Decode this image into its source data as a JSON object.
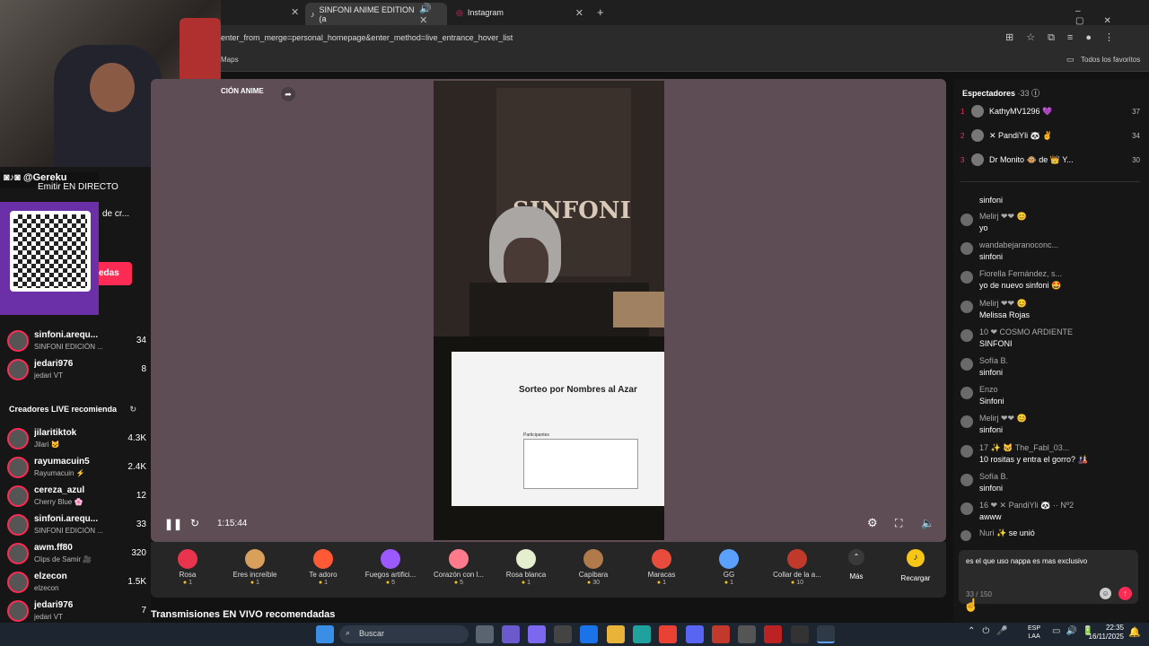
{
  "browser": {
    "tabs": [
      {
        "label": "SINFONI ANIME EDITION (a"
      },
      {
        "label": "Instagram"
      }
    ],
    "url": "enter_from_merge=personal_homepage&enter_method=live_entrance_hover_list",
    "bookmarks": {
      "left": "Maps",
      "right": "Todos los favoritos"
    }
  },
  "overlay": {
    "social": "@Gereku",
    "live_btn": "Emitir EN DIRECTO",
    "snippet": "de cr...",
    "button": "edas"
  },
  "player": {
    "live_label": "CIÓN ANIME",
    "time": "1:15:44",
    "screen_title": "Sorteo por Nombres al Azar",
    "screen_list_title": "Participantes"
  },
  "left": {
    "top_creators": [
      {
        "name": "sinfoni.arequ...",
        "sub": "SINFONI EDICIÓN ...",
        "count": "34"
      },
      {
        "name": "jedari976",
        "sub": "jedari VT",
        "count": "8"
      }
    ],
    "section_title": "Creadores LIVE recomienda",
    "creators": [
      {
        "name": "jilaritiktok",
        "sub": "Jilari 🐱",
        "count": "4.3K"
      },
      {
        "name": "rayumacuin5",
        "sub": "Rayumacuin ⚡",
        "count": "2.4K"
      },
      {
        "name": "cereza_azul",
        "sub": "Cherry Blue 🌸",
        "count": "12"
      },
      {
        "name": "sinfoni.arequ...",
        "sub": "SINFONI EDICIÓN ...",
        "count": "33"
      },
      {
        "name": "awm.ff80",
        "sub": "Clips de Samir 🎥",
        "count": "320"
      },
      {
        "name": "elzecon",
        "sub": "elzecon",
        "count": "1.5K"
      },
      {
        "name": "jedari976",
        "sub": "jedari VT",
        "count": "7"
      }
    ],
    "bottom_title": "Transmisiones EN VIVO recomendadas"
  },
  "gifts": [
    {
      "name": "Rosa",
      "price": "1",
      "color": "#e8344d"
    },
    {
      "name": "Eres increíble",
      "price": "1",
      "color": "#d9a05b"
    },
    {
      "name": "Te adoro",
      "price": "1",
      "color": "#ff5a36"
    },
    {
      "name": "Fuegos artifici...",
      "price": "5",
      "color": "#9b59ff"
    },
    {
      "name": "Corazón con l...",
      "price": "5",
      "color": "#ff7a8a"
    },
    {
      "name": "Rosa blanca",
      "price": "1",
      "color": "#e6eed0"
    },
    {
      "name": "Capibara",
      "price": "30",
      "color": "#b07a4a"
    },
    {
      "name": "Maracas",
      "price": "1",
      "color": "#e74c3c"
    },
    {
      "name": "GG",
      "price": "1",
      "color": "#5aa0ff"
    },
    {
      "name": "Collar de la a...",
      "price": "10",
      "color": "#c0392b"
    }
  ],
  "more_label": "Más",
  "recharge_label": "Recargar",
  "viewers": {
    "title": "Espectadores",
    "count": "·33",
    "list": [
      {
        "rank": "1",
        "name": "KathyMV1296 💜",
        "count": "37"
      },
      {
        "rank": "2",
        "name": "✕ PandiYli 🐼 ✌",
        "count": "34"
      },
      {
        "rank": "3",
        "name": "Dr Monito 🐵 de 👑 Y...",
        "count": "30"
      }
    ]
  },
  "chat": [
    {
      "user": "",
      "text": "sinfoni"
    },
    {
      "user": "Melirj ❤❤ 😊",
      "text": "yo"
    },
    {
      "user": "wandabejaranoconc...",
      "text": "sinfoni"
    },
    {
      "user": "Fiorella Fernández, s...",
      "text": "yo de nuevo sinfoni 🤩"
    },
    {
      "user": "Melirj ❤❤ 😊",
      "text": "Melissa Rojas"
    },
    {
      "user": "10 ❤ COSMO ARDIENTE",
      "text": "SINFONI"
    },
    {
      "user": "Sofía B.",
      "text": "sinfoni"
    },
    {
      "user": "Enzo",
      "text": "Sinfoni"
    },
    {
      "user": "Melirj ❤❤ 😊",
      "text": "sinfoni"
    },
    {
      "user": "17 ✨ 🐱 The_Fabl_03...",
      "text": "10 rositas y entra el gorro? 🎎"
    },
    {
      "user": "Sofía B.",
      "text": "sinfoni"
    },
    {
      "user": "16 ❤ ✕ PandiYli 🐼 ·· Nº2",
      "text": "awww"
    }
  ],
  "join": {
    "user": "Nuri ✨",
    "text": "se unió"
  },
  "input": {
    "value": "es el que uso nappa es mas exclusivo",
    "counter": "33 / 150"
  },
  "taskbar": {
    "search": "Buscar",
    "lang": "ESP",
    "lang2": "LAA",
    "time": "22:35",
    "date": "16/11/2025"
  }
}
